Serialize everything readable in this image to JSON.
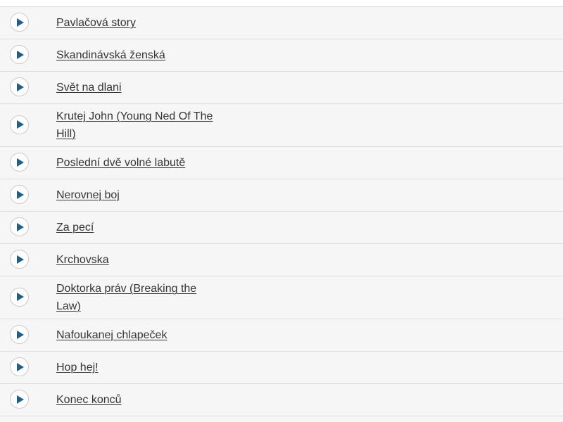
{
  "tracks": [
    {
      "title": "Pavlačová story"
    },
    {
      "title": "Skandinávská ženská"
    },
    {
      "title": "Svět na dlani"
    },
    {
      "title": "Krutej John (Young Ned Of The Hill)"
    },
    {
      "title": "Poslední dvě volné labutě"
    },
    {
      "title": "Nerovnej boj"
    },
    {
      "title": "Za pecí"
    },
    {
      "title": "Krchovska"
    },
    {
      "title": "Doktorka práv (Breaking the Law)"
    },
    {
      "title": "Nafoukanej chlapeček"
    },
    {
      "title": "Hop hej!"
    },
    {
      "title": "Konec konců"
    }
  ],
  "icons": {
    "play": "play-icon"
  },
  "colors": {
    "play_accent": "#1f5f8b",
    "text": "#353535",
    "divider": "#dcdcdc",
    "background": "#f6f6f6"
  }
}
